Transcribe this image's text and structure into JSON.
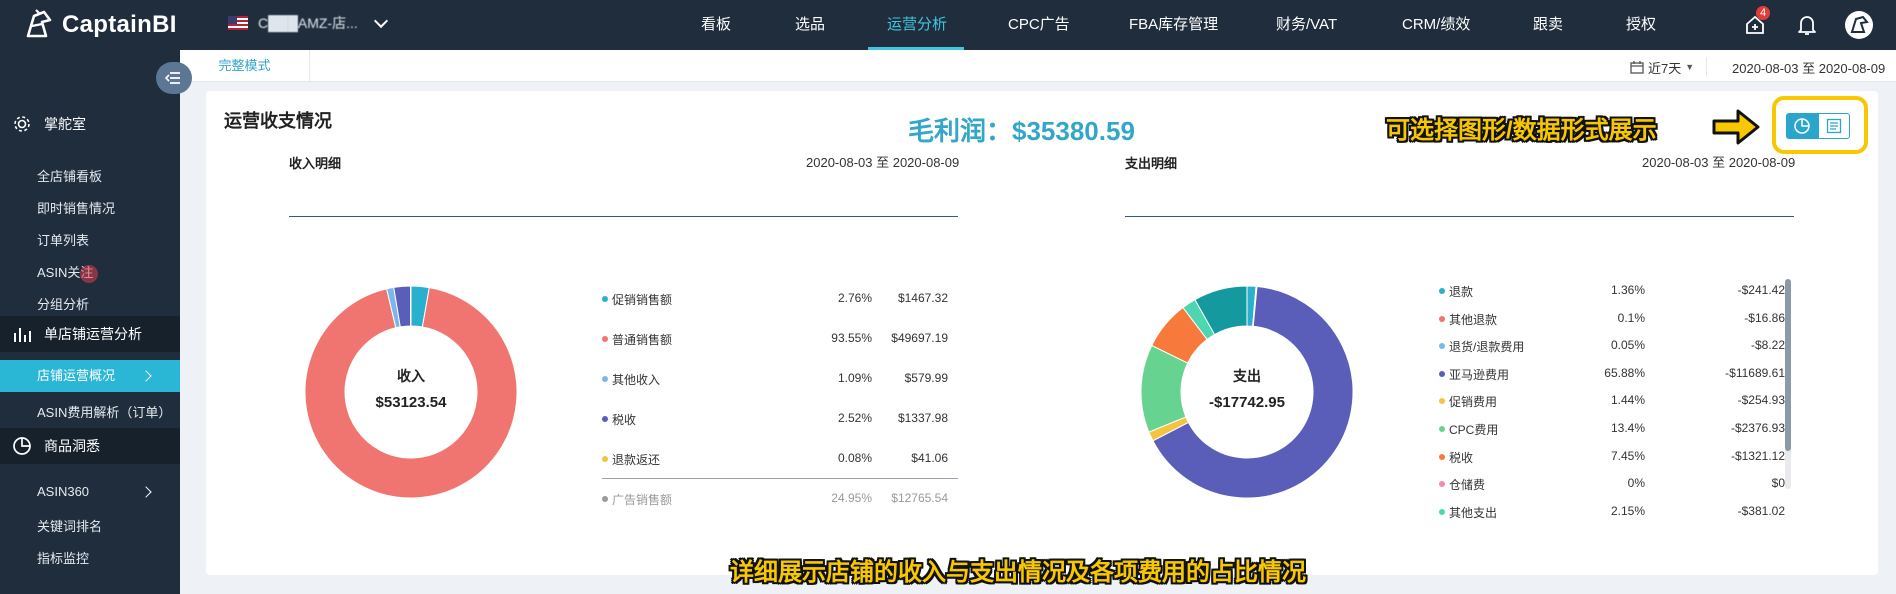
{
  "app": {
    "name": "CaptainBI"
  },
  "store": {
    "name": "C███AMZ-店..."
  },
  "nav": [
    {
      "label": "看板",
      "active": false
    },
    {
      "label": "选品",
      "active": false
    },
    {
      "label": "运营分析",
      "active": true
    },
    {
      "label": "CPC广告",
      "active": false
    },
    {
      "label": "FBA库存管理",
      "active": false
    },
    {
      "label": "财务/VAT",
      "active": false
    },
    {
      "label": "CRM/绩效",
      "active": false
    },
    {
      "label": "跟卖",
      "active": false
    },
    {
      "label": "授权",
      "active": false
    }
  ],
  "notifications": {
    "count": "4"
  },
  "subbar": {
    "mode": "完整模式",
    "range": "近7天",
    "date_range": "2020-08-03 至 2020-08-09"
  },
  "sidebar": {
    "group1": "掌舵室",
    "group1_items": [
      "全店铺看板",
      "即时销售情况",
      "订单列表",
      "ASIN关注",
      "分组分析"
    ],
    "group2": "单店铺运营分析",
    "active_item": "店铺运营概况",
    "group2_items": [
      "ASIN费用解析（订单）"
    ],
    "group3": "商品洞悉",
    "group3_items": [
      "ASIN360",
      "关键词排名",
      "指标监控"
    ]
  },
  "panel": {
    "title": "运营收支情况",
    "profit": "毛利润：$35380.59",
    "hint_top": "可选择图形/数据形式展示",
    "hint_bottom": "详细展示店铺的收入与支出情况及各项费用的占比情况"
  },
  "income": {
    "title": "收入明细",
    "date": "2020-08-03 至 2020-08-09",
    "center_label": "收入",
    "center_value": "$53123.54",
    "items": [
      {
        "name": "促销销售额",
        "pct": "2.76%",
        "amount": "$1467.32",
        "color": "#2ab0cf",
        "share": 2.76
      },
      {
        "name": "普通销售额",
        "pct": "93.55%",
        "amount": "$49697.19",
        "color": "#f07470",
        "share": 93.55
      },
      {
        "name": "其他收入",
        "pct": "1.09%",
        "amount": "$579.99",
        "color": "#7ab7ee",
        "share": 1.09
      },
      {
        "name": "税收",
        "pct": "2.52%",
        "amount": "$1337.98",
        "color": "#5a5eb8",
        "share": 2.52
      },
      {
        "name": "退款返还",
        "pct": "0.08%",
        "amount": "$41.06",
        "color": "#f5c242",
        "share": 0.08
      }
    ],
    "footer": {
      "name": "广告销售额",
      "pct": "24.95%",
      "amount": "$12765.54",
      "color": "#999999"
    }
  },
  "expense": {
    "title": "支出明细",
    "date": "2020-08-03 至 2020-08-09",
    "center_label": "支出",
    "center_value": "-$17742.95",
    "items": [
      {
        "name": "退款",
        "pct": "1.36%",
        "amount": "-$241.42",
        "color": "#2ab0cf",
        "share": 1.36
      },
      {
        "name": "其他退款",
        "pct": "0.1%",
        "amount": "-$16.86",
        "color": "#f07470",
        "share": 0.1
      },
      {
        "name": "退货/退款费用",
        "pct": "0.05%",
        "amount": "-$8.22",
        "color": "#7ab7ee",
        "share": 0.05
      },
      {
        "name": "亚马逊费用",
        "pct": "65.88%",
        "amount": "-$11689.61",
        "color": "#5a5eb8",
        "share": 65.88
      },
      {
        "name": "促销费用",
        "pct": "1.44%",
        "amount": "-$254.93",
        "color": "#f5c242",
        "share": 1.44
      },
      {
        "name": "CPC费用",
        "pct": "13.4%",
        "amount": "-$2376.93",
        "color": "#66d490",
        "share": 13.4
      },
      {
        "name": "税收",
        "pct": "7.45%",
        "amount": "-$1321.12",
        "color": "#f77a3c",
        "share": 7.45
      },
      {
        "name": "仓储费",
        "pct": "0%",
        "amount": "$0",
        "color": "#f58ab0",
        "share": 0
      },
      {
        "name": "其他支出",
        "pct": "2.15%",
        "amount": "-$381.02",
        "color": "#4ed6b0",
        "share": 2.15
      },
      {
        "name": "",
        "pct": "",
        "amount": "",
        "color": "#14999e",
        "share": 8.17
      }
    ]
  }
}
